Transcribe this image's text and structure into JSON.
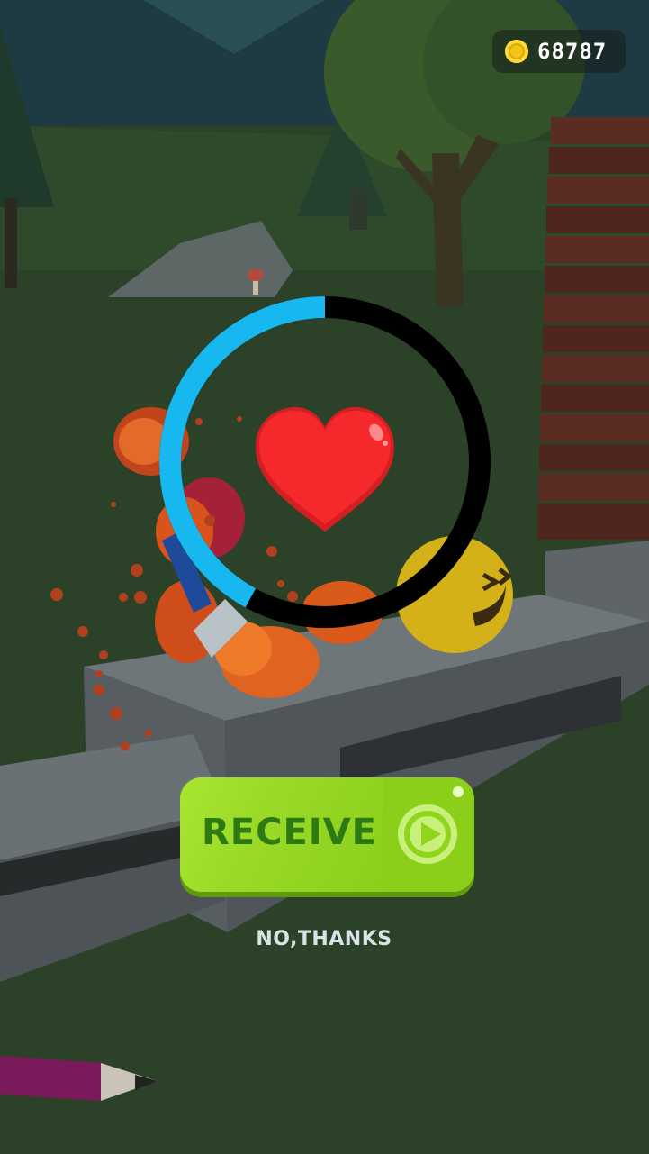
{
  "hud": {
    "coin_icon": "coin-icon",
    "coin_count": "68787"
  },
  "reward_timer": {
    "progress_fraction": 0.42,
    "icon": "heart-icon",
    "colors": {
      "progress": "#17b7f0",
      "track": "#000000",
      "heart": "#f5282b"
    }
  },
  "actions": {
    "receive_label": "RECEIVE",
    "receive_icon": "play-icon",
    "no_thanks_label": "NO,THANKS"
  },
  "colors": {
    "button": "#8fd41d",
    "button_text": "#2d7a12"
  }
}
